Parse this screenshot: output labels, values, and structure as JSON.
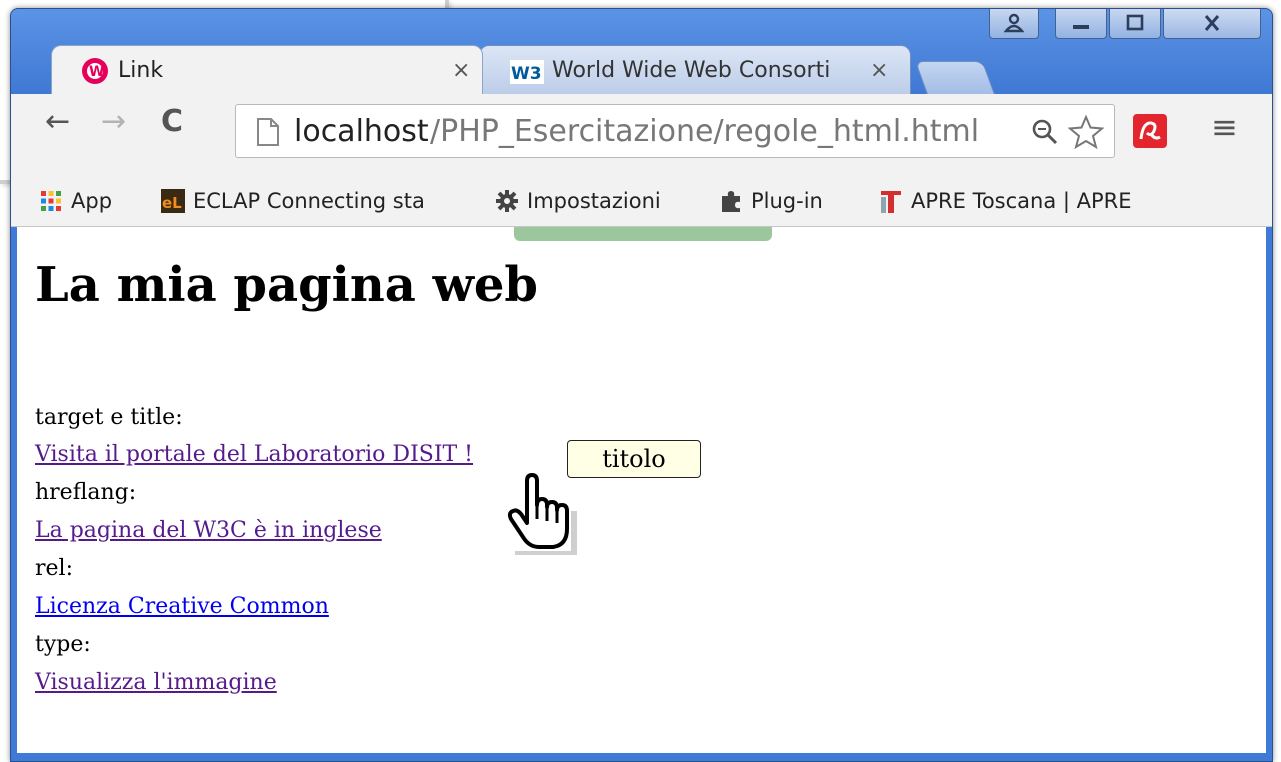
{
  "window": {
    "tabs": [
      {
        "title": "Link",
        "icon": "wampserver-icon",
        "active": true,
        "close": "×"
      },
      {
        "title": "World Wide Web Consorti",
        "icon": "w3c-icon",
        "active": false,
        "close": "×"
      }
    ],
    "caption_buttons": [
      "user-icon",
      "minimize-icon",
      "maximize-icon",
      "close-icon"
    ]
  },
  "toolbar": {
    "back": "←",
    "forward": "→",
    "reload": "C",
    "url_host": "localhost",
    "url_path": "/PHP_Esercitazione/regole_html.html",
    "extension_icon": "avira-icon",
    "menu": "≡"
  },
  "bookmarks": [
    {
      "label": "App",
      "icon": "apps-grid-icon"
    },
    {
      "label": "ECLAP Connecting sta",
      "icon": "eclap-icon"
    },
    {
      "label": "Impostazioni",
      "icon": "gear-icon"
    },
    {
      "label": "Plug-in",
      "icon": "puzzle-icon"
    },
    {
      "label": "APRE Toscana | APRE",
      "icon": "apre-icon"
    }
  ],
  "page": {
    "heading": "La mia pagina web",
    "lines": [
      {
        "kind": "text",
        "text": "target e title:"
      },
      {
        "kind": "link",
        "text": "Visita il portale del Laboratorio DISIT !",
        "visited": true
      },
      {
        "kind": "text",
        "text": "hreflang:"
      },
      {
        "kind": "link",
        "text": "La pagina del W3C è in inglese",
        "visited": true
      },
      {
        "kind": "text",
        "text": "rel:"
      },
      {
        "kind": "link",
        "text": "Licenza Creative Common",
        "visited": false
      },
      {
        "kind": "text",
        "text": "type:"
      },
      {
        "kind": "link",
        "text": "Visualizza l'immagine",
        "visited": true
      }
    ],
    "tooltip": "titolo"
  },
  "colors": {
    "frame": "#3f7ad7",
    "visited_link": "#551a8b",
    "unvisited_link": "#0000ee",
    "tooltip_bg": "#ffffe6"
  }
}
